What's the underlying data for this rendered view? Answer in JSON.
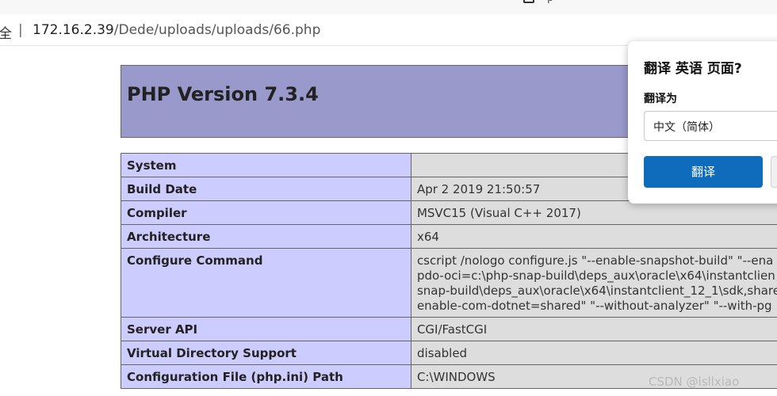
{
  "browser": {
    "tab_fragment_text": "p",
    "address_prefix": "全",
    "address_separator": "|",
    "url_host": "172.16.2.39",
    "url_path": "/Dede/uploads/uploads/66.php"
  },
  "php_info": {
    "title": "PHP Version 7.3.4",
    "rows": [
      {
        "key": "System",
        "value_lines": [
          ""
        ]
      },
      {
        "key": "Build Date",
        "value_lines": [
          "Apr 2 2019 21:50:57"
        ]
      },
      {
        "key": "Compiler",
        "value_lines": [
          "MSVC15 (Visual C++ 2017)"
        ]
      },
      {
        "key": "Architecture",
        "value_lines": [
          "x64"
        ]
      },
      {
        "key": "Configure Command",
        "value_lines": [
          "cscript /nologo configure.js \"--enable-snapshot-build\" \"--ena",
          "pdo-oci=c:\\php-snap-build\\deps_aux\\oracle\\x64\\instantclien",
          "snap-build\\deps_aux\\oracle\\x64\\instantclient_12_1\\sdk,share",
          "enable-com-dotnet=shared\" \"--without-analyzer\" \"--with-pg"
        ]
      },
      {
        "key": "Server API",
        "value_lines": [
          "CGI/FastCGI"
        ]
      },
      {
        "key": "Virtual Directory Support",
        "value_lines": [
          "disabled"
        ]
      },
      {
        "key": "Configuration File (php.ini) Path",
        "value_lines": [
          "C:\\WINDOWS"
        ]
      }
    ]
  },
  "translate_popup": {
    "title": "翻译 英语 页面?",
    "label": "翻译为",
    "selected_language": "中文（简体）",
    "translate_button": "翻译"
  },
  "watermark": "CSDN @isllxiao"
}
